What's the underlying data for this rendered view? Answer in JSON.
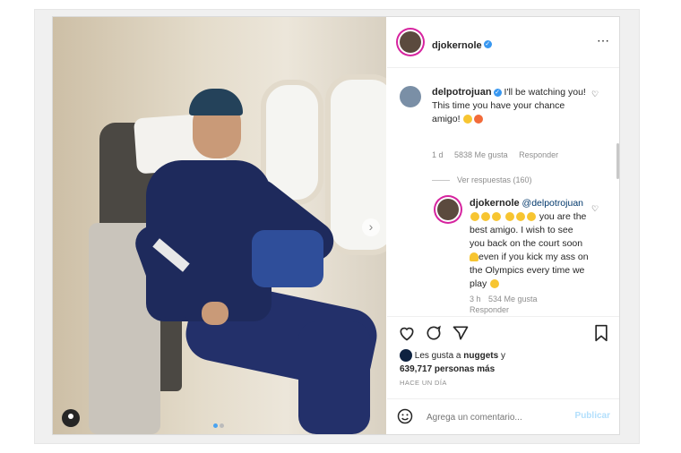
{
  "post": {
    "author": "djokernole",
    "more_icon": "⋯"
  },
  "photo": {
    "next_icon": "›"
  },
  "comments": [
    {
      "user": "delpotrojuan",
      "text": "I'll be watching you! This time you have your chance amigo!",
      "age": "1 d",
      "likes": "5838 Me gusta",
      "reply_label": "Responder",
      "heart_icon": "♡"
    }
  ],
  "view_replies": "Ver respuestas (160)",
  "reply": {
    "user": "djokernole",
    "mention": "@delpotrojuan",
    "text1": "you are the best amigo. I wish to see you back on the court soon",
    "text2": "even if you kick my ass on the Olympics every time we play",
    "age": "3 h",
    "likes": "534 Me gusta",
    "reply_label": "Responder",
    "heart_icon": "♡"
  },
  "actions": {
    "like_icon": "♡",
    "comment_icon": "◯",
    "share_icon": "➤",
    "save_icon": "🔖"
  },
  "likes_line": {
    "prefix": "Les gusta a",
    "user": "nuggets",
    "connector": "y",
    "count": "639,717 personas más"
  },
  "timestamp": "HACE UN DÍA",
  "composer": {
    "emoji_icon": "☺",
    "placeholder": "Agrega un comentario...",
    "post_label": "Publicar"
  },
  "colors": {
    "verified": "#3897f0",
    "post_button_disabled": "#b2dffc",
    "story_ring": "#d6249f"
  }
}
